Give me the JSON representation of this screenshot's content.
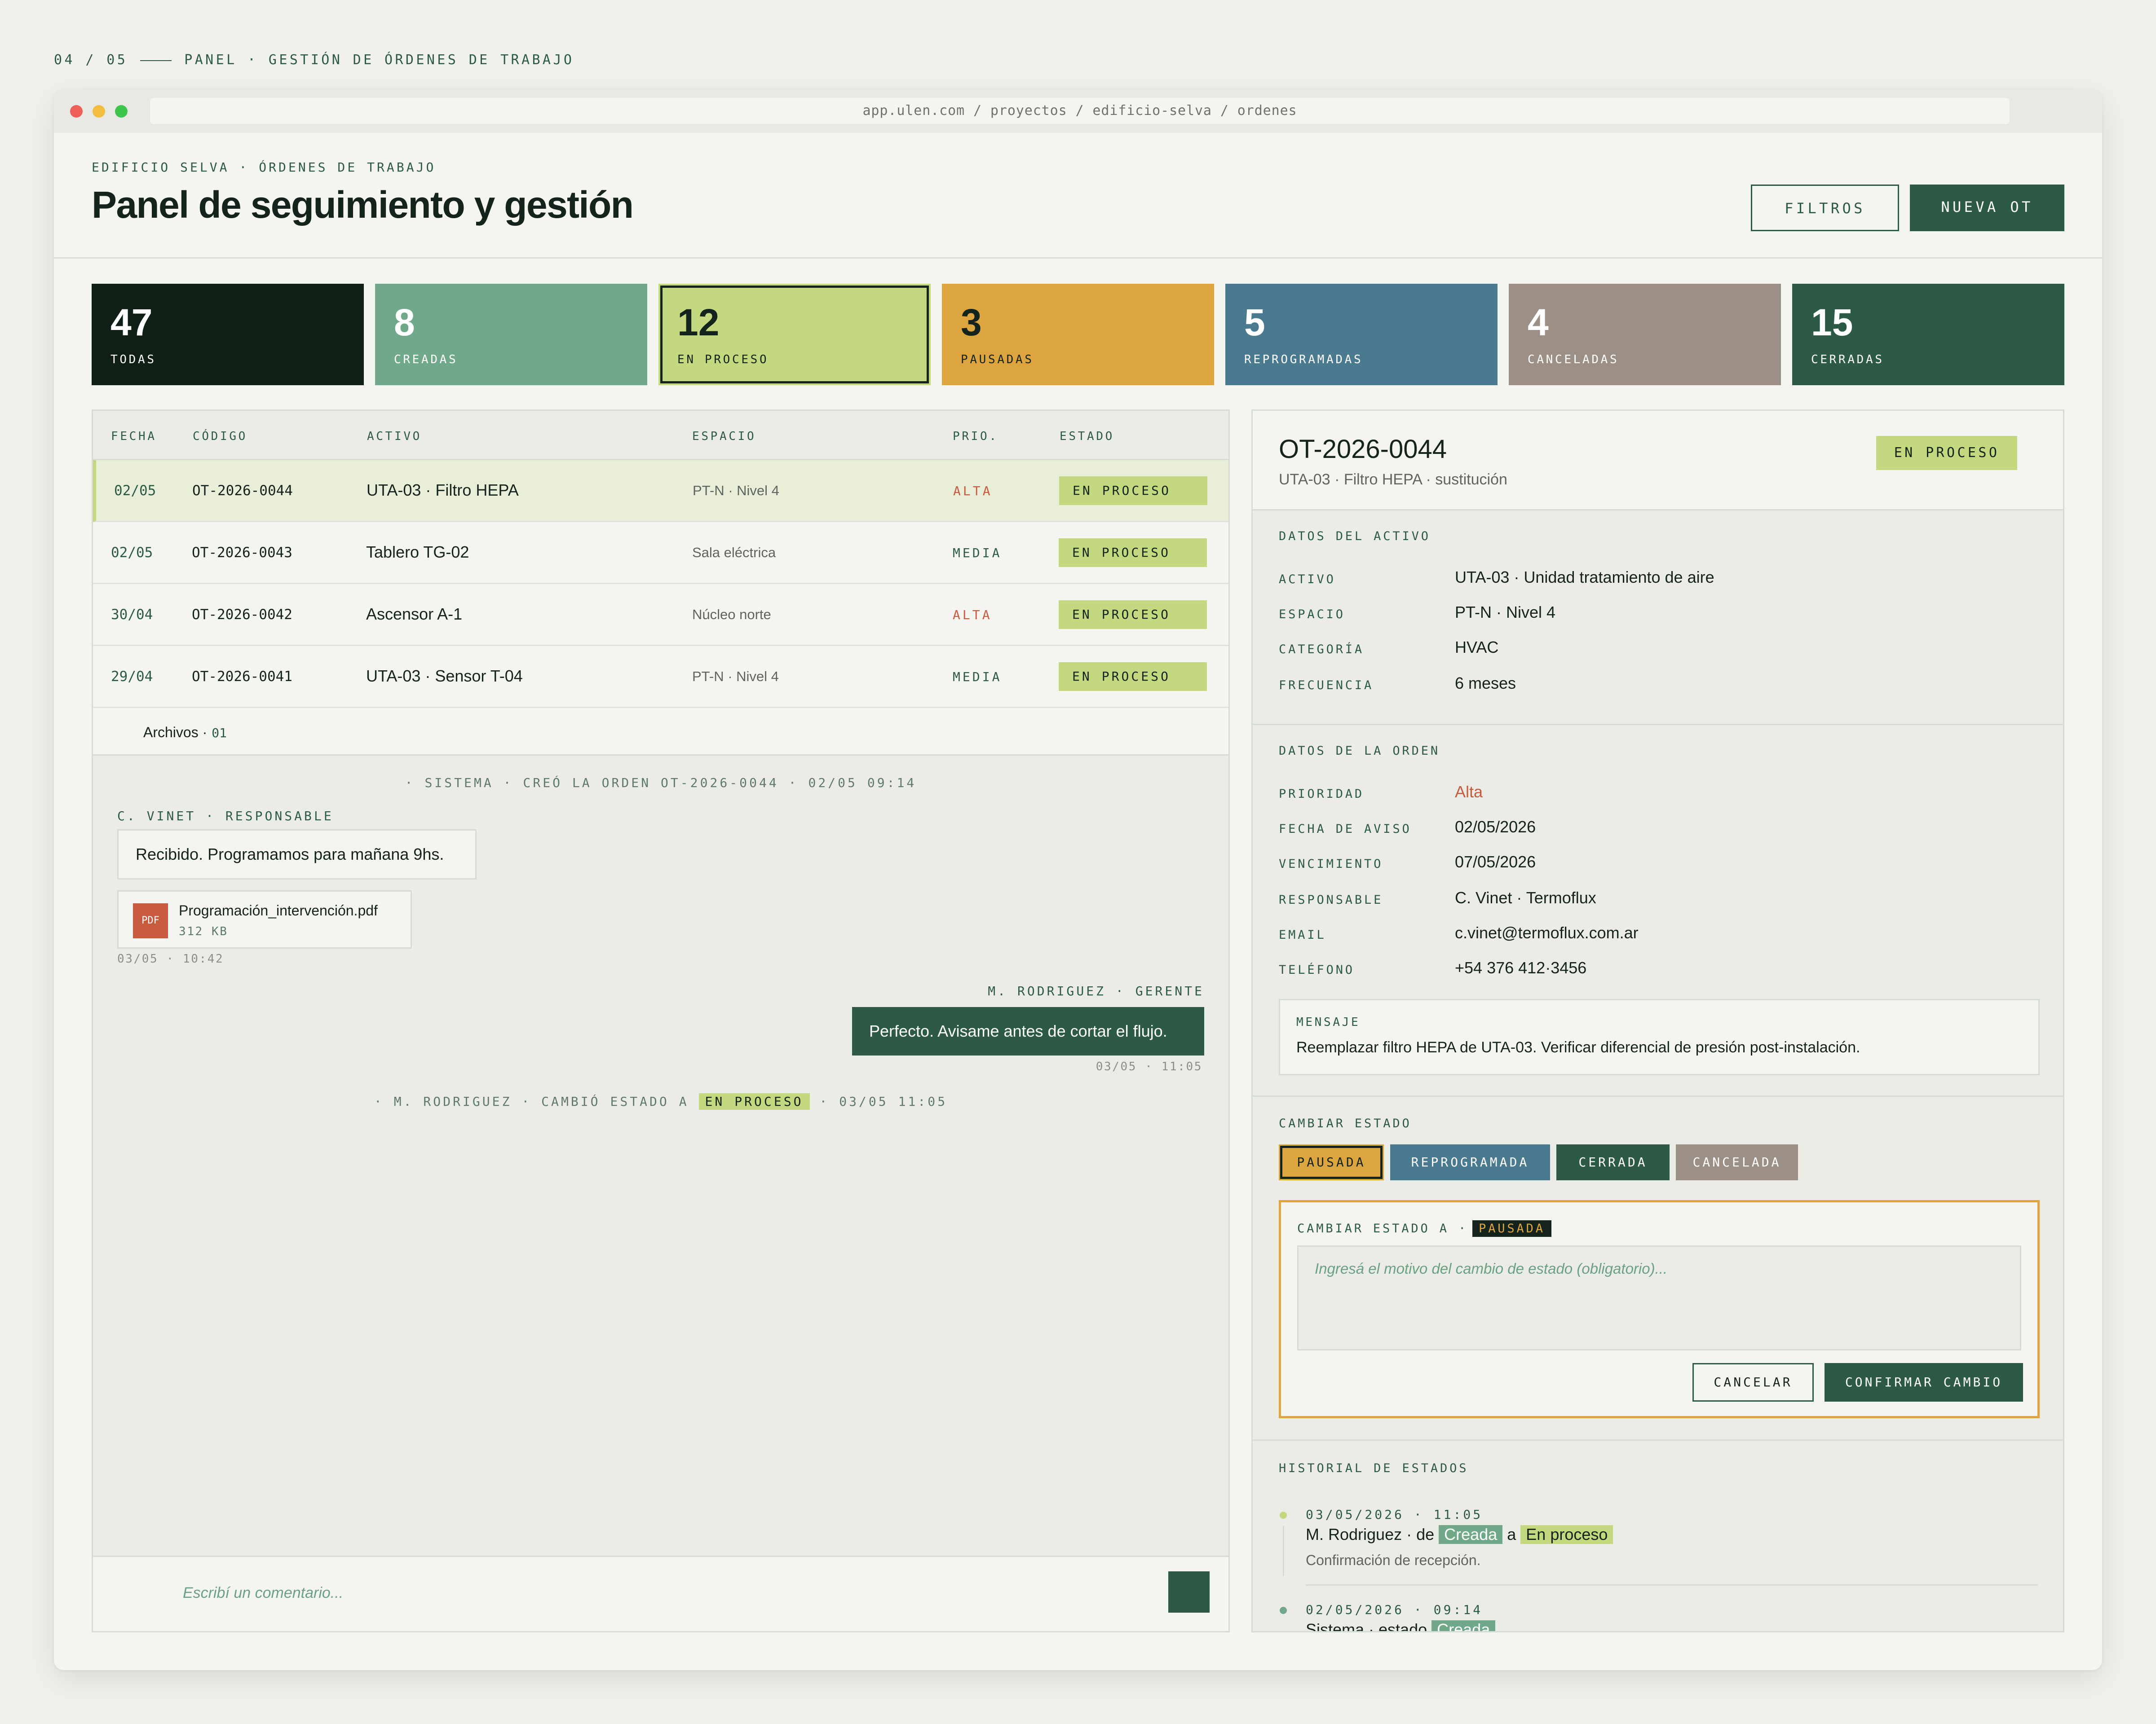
{
  "slide": {
    "index": "04 / 05",
    "section": "PANEL · GESTIÓN DE ÓRDENES DE TRABAJO"
  },
  "browser": {
    "url": "app.ulen.com / proyectos / edificio-selva / ordenes"
  },
  "header": {
    "eyebrow": "EDIFICIO SELVA · ÓRDENES DE TRABAJO",
    "title": "Panel de seguimiento y gestión",
    "filters_label": "FILTROS",
    "new_label": "NUEVA OT"
  },
  "stats": [
    {
      "count": "47",
      "label": "TODAS",
      "color": "#0f1f16"
    },
    {
      "count": "8",
      "label": "CREADAS",
      "color": "#6fa98a"
    },
    {
      "count": "12",
      "label": "EN PROCESO",
      "color": "#c4d97f"
    },
    {
      "count": "3",
      "label": "PAUSADAS",
      "color": "#dca53f"
    },
    {
      "count": "5",
      "label": "REPROGRAMADAS",
      "color": "#4a7a8f"
    },
    {
      "count": "4",
      "label": "CANCELADAS",
      "color": "#9c9086"
    },
    {
      "count": "15",
      "label": "CERRADAS",
      "color": "#2d5a45"
    }
  ],
  "table": {
    "columns": [
      "FECHA",
      "CÓDIGO",
      "ACTIVO",
      "ESPACIO",
      "PRIO.",
      "ESTADO"
    ],
    "rows": [
      {
        "date": "02/05",
        "code": "OT-2026-0044",
        "asset": "UTA-03 · Filtro HEPA",
        "space": "PT-N · Nivel 4",
        "priority": "ALTA",
        "status": "EN PROCESO"
      },
      {
        "date": "02/05",
        "code": "OT-2026-0043",
        "asset": "Tablero TG-02",
        "space": "Sala eléctrica",
        "priority": "MEDIA",
        "status": "EN PROCESO"
      },
      {
        "date": "30/04",
        "code": "OT-2026-0042",
        "asset": "Ascensor A-1",
        "space": "Núcleo norte",
        "priority": "ALTA",
        "status": "EN PROCESO"
      },
      {
        "date": "29/04",
        "code": "OT-2026-0041",
        "asset": "UTA-03 · Sensor T-04",
        "space": "PT-N · Nivel 4",
        "priority": "MEDIA",
        "status": "EN PROCESO"
      }
    ]
  },
  "files": {
    "label": "Archivos ·",
    "count": "01"
  },
  "activity": {
    "system_created": "· SISTEMA · CREÓ LA ORDEN OT-2026-0044 · 02/05 09:14",
    "comment1": {
      "author": "C. VINET · RESPONSABLE",
      "text": "Recibido. Programamos para mañana 9hs.",
      "attachment_name": "Programación_intervención.pdf",
      "attachment_size": "312 KB",
      "attachment_type": "PDF",
      "time": "03/05 · 10:42"
    },
    "comment2": {
      "author": "M. RODRIGUEZ · GERENTE",
      "text": "Perfecto. Avisame antes de cortar el flujo.",
      "time": "03/05 · 11:05"
    },
    "status_change": {
      "prefix": "· M. RODRIGUEZ · CAMBIÓ ESTADO A",
      "status": "EN PROCESO",
      "suffix": "· 03/05 11:05"
    }
  },
  "comment_box": {
    "placeholder": "Escribí un comentario..."
  },
  "detail": {
    "code": "OT-2026-0044",
    "subtitle": "UTA-03 · Filtro HEPA · sustitución",
    "status": "EN PROCESO",
    "asset_section": {
      "title": "DATOS DEL ACTIVO",
      "fields": [
        {
          "key": "ACTIVO",
          "value": "UTA-03 · Unidad tratamiento de aire"
        },
        {
          "key": "ESPACIO",
          "value": "PT-N · Nivel 4"
        },
        {
          "key": "CATEGORÍA",
          "value": "HVAC"
        },
        {
          "key": "FRECUENCIA",
          "value": "6 meses"
        }
      ]
    },
    "order_section": {
      "title": "DATOS DE LA ORDEN",
      "fields": [
        {
          "key": "PRIORIDAD",
          "value": "Alta"
        },
        {
          "key": "FECHA DE AVISO",
          "value": "02/05/2026"
        },
        {
          "key": "VENCIMIENTO",
          "value": "07/05/2026"
        },
        {
          "key": "RESPONSABLE",
          "value": "C. Vinet · Termoflux"
        },
        {
          "key": "EMAIL",
          "value": "c.vinet@termoflux.com.ar"
        },
        {
          "key": "TELÉFONO",
          "value": "+54 376 412·3456"
        }
      ],
      "message_label": "MENSAJE",
      "message": "Reemplazar filtro HEPA de UTA-03. Verificar diferencial de presión post-instalación."
    },
    "change_status": {
      "title": "CAMBIAR ESTADO",
      "options": [
        "PAUSADA",
        "REPROGRAMADA",
        "CERRADA",
        "CANCELADA"
      ],
      "selected": "PAUSADA",
      "form_label": "CAMBIAR ESTADO A ·",
      "reason_placeholder": "Ingresá el motivo del cambio de estado (obligatorio)...",
      "cancel_label": "CANCELAR",
      "confirm_label": "CONFIRMAR CAMBIO"
    },
    "history": {
      "title": "HISTORIAL DE ESTADOS",
      "entries": [
        {
          "date": "03/05/2026 · 11:05",
          "actor": "M. Rodriguez · de",
          "from": "Creada",
          "joiner": "a",
          "to": "En proceso",
          "note": "Confirmación de recepción."
        },
        {
          "date": "02/05/2026 · 09:14",
          "actor": "Sistema · estado",
          "from": "Creada"
        }
      ]
    }
  },
  "colors": {
    "primary": "#2d5a45",
    "in_process": "#c4d97f",
    "paused": "#dca53f",
    "rescheduled": "#4a7a8f",
    "cancelled": "#9c9086",
    "high_priority": "#c85a3e"
  }
}
